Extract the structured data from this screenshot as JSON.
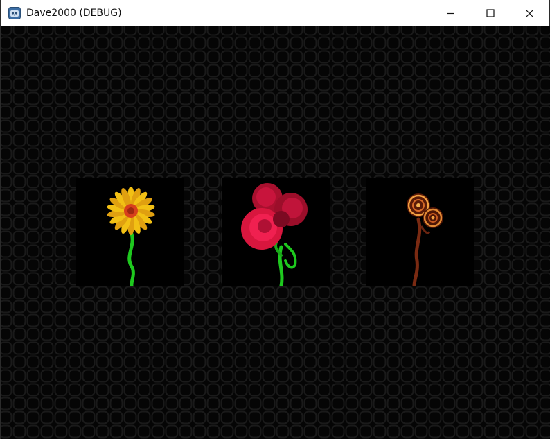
{
  "window": {
    "title": "Dave2000 (DEBUG)",
    "app_icon": "godot-engine-icon",
    "controls": {
      "minimize_icon": "minimize-icon",
      "maximize_icon": "maximize-icon",
      "close_icon": "close-icon"
    }
  },
  "scene": {
    "background_color": "#050505",
    "grid_color": "#1a1a1a",
    "flowers": [
      {
        "kind": "yellow-daisy",
        "petal_color": "#f2c014",
        "center_color": "#d8401c",
        "stem_color": "#1ec81e"
      },
      {
        "kind": "red-roses",
        "petal_color": "#c8143c",
        "stem_color": "#1ec81e"
      },
      {
        "kind": "dried-roses",
        "petal_color": "#d86a28",
        "stem_color": "#7a2a12"
      }
    ]
  }
}
